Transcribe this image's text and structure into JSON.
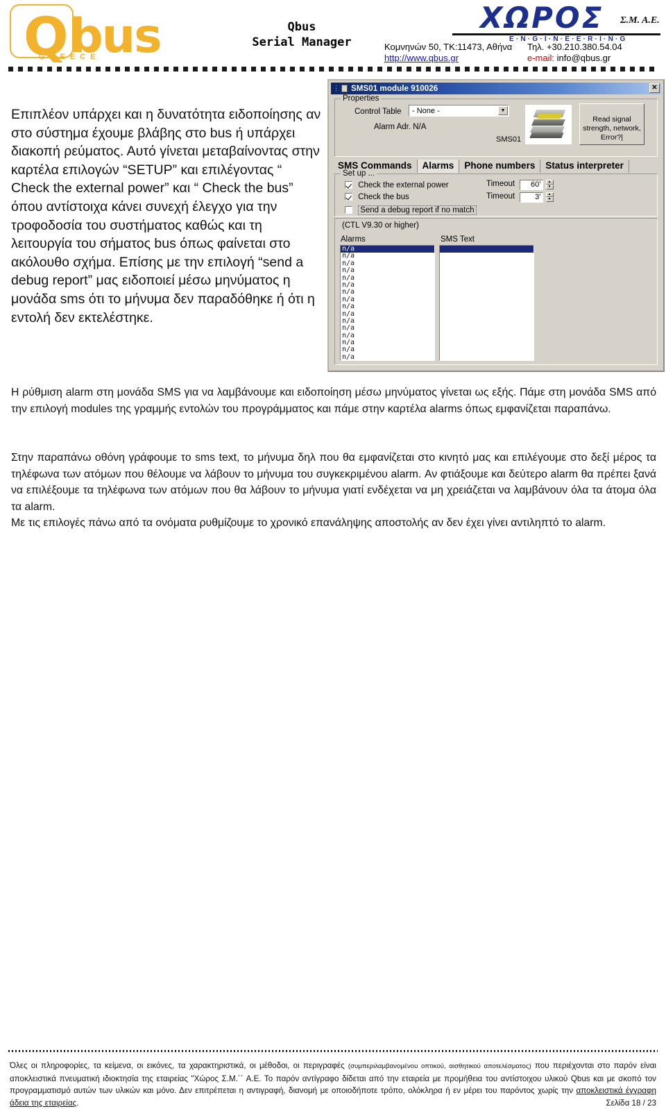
{
  "header": {
    "logo": {
      "q": "Q",
      "bus": "bus",
      "sub": "GREECE"
    },
    "app_title_line1": "Qbus",
    "app_title_line2": "Serial Manager",
    "company": {
      "name": "ΧΩΡΟΣ",
      "suffix": "Σ.Μ. Α.Ε.",
      "tagline": "E·N·G·I·N·E·E·R·I·N·G",
      "address": "Κομνηνών 50,  ΤΚ:11473, Αθήνα",
      "phone": "Τηλ. +30.210.380.54.04",
      "website": "http://www.qbus.gr",
      "email_label": "e-mail:",
      "email": "info@qbus.gr"
    },
    "accent_color": "#F2B22B",
    "company_color": "#1c2f8c",
    "email_color": "#cc0000",
    "link_color": "#1414cc"
  },
  "body": {
    "intro": "Επιπλέον υπάρχει και η δυνατότητα ειδοποίησης αν στο σύστημα έχουμε βλάβης στο bus ή υπάρχει διακοπή ρεύματος. Αυτό γίνεται μεταβαίνοντας στην καρτέλα επιλογών  “SETUP”  και επιλέγοντας “ Check the external power” και  “ Check the bus” όπου αντίστοιχα κάνει συνεχή έλεγχο για την τροφοδοσία του συστήματος καθώς και τη λειτουργία του σήματος bus όπως φαίνεται στο ακόλουθο σχήμα. Επίσης με την επιλογή “send a debug report” μας ειδοποιεί μέσω μηνύματος η μονάδα sms ότι το μήνυμα δεν παραδόθηκε ή ότι η εντολή δεν εκτελέστηκε.",
    "paragraph1": "Η ρύθμιση alarm στη μονάδα SMS για να λαμβάνουμε και ειδοποίηση μέσω μηνύματος γίνεται ως εξής. Πάμε στη μονάδα SMS από την επιλογή modules της γραμμής εντολών του προγράμματος και πάμε στην καρτέλα alarms όπως εμφανίζεται παραπάνω.",
    "paragraph2": "Στην παραπάνω οθόνη γράφουμε το sms text, το μήνυμα δηλ που θα εμφανίζεται στο κινητό μας και επιλέγουμε στο δεξί μέρος τα τηλέφωνα των ατόμων που θέλουμε να λάβουν το μήνυμα του συγκεκριμένου alarm. Αν φτιάξουμε και δεύτερο alarm θα πρέπει ξανά να επιλέξουμε τα τηλέφωνα των ατόμων που θα λάβουν το μήνυμα γιατί ενδέχεται να μη χρειάζεται να λαμβάνουν όλα τα άτομα όλα τα alarm.",
    "paragraph2b": "Με τις επιλογές πάνω από τα ονόματα ρυθμίζουμε το χρονικό επανάληψης αποστολής αν δεν έχει γίνει αντιληπτό το alarm."
  },
  "app_window": {
    "title": "SMS01 module 910026",
    "close_label": "✕",
    "properties": {
      "group_label": "Properties",
      "control_table_label": "Control Table",
      "control_table_value": "- None -",
      "alarm_adr_label": "Alarm Adr. N/A",
      "module_caption": "SMS01",
      "read_button": "Read signal strength, network, Error?|"
    },
    "tabs": [
      {
        "label": "SMS Commands",
        "active": false
      },
      {
        "label": "Alarms",
        "active": true
      },
      {
        "label": "Phone numbers",
        "active": false
      },
      {
        "label": "Status interpreter",
        "active": false
      }
    ],
    "setup": {
      "group_label": "Set up ...",
      "check_external_power": "Check the external power",
      "check_external_power_checked": true,
      "check_bus": "Check the bus",
      "check_bus_checked": true,
      "send_debug_report": "Send a debug report if no match",
      "send_debug_report_checked": false,
      "timeout_label_1": "Timeout",
      "timeout_value_1": "60'",
      "timeout_label_2": "Timeout",
      "timeout_value_2": "3'"
    },
    "alarms_panel": {
      "ctl_note": "(CTL V9.30 or higher)",
      "col_alarms": "Alarms",
      "col_sms_text": "SMS Text",
      "alarm_rows": [
        "n/a",
        "n/a",
        "n/a",
        "n/a",
        "n/a",
        "n/a",
        "n/a",
        "n/a",
        "n/a",
        "n/a",
        "n/a",
        "n/a",
        "n/a",
        "n/a",
        "n/a",
        "n/a"
      ],
      "selected_index": 0,
      "sms_text_rows": [
        "",
        "",
        "",
        "",
        "",
        "",
        "",
        "",
        "",
        "",
        "",
        "",
        "",
        "",
        "",
        ""
      ],
      "selection_color": "#1b2a78"
    }
  },
  "footer": {
    "line1a": "Όλες οι πληροφορίες, τα κείμενα, οι εικόνες, τα χαρακτηριστικά, οι μέθοδοι, οι περιγραφές ",
    "line1b": "(συμπεριλαμβανομένου οπτικού, αισθητικού αποτελέσματος)",
    "line2": "που περιέχονται στο παρόν είναι αποκλειστικά πνευματική ιδιοκτησία της εταιρείας \"Χώρος Σ.Μ.´´ Α.Ε.  Το παρόν αντίγραφο δίδεται από την",
    "line3": "εταιρεία με προμήθεια του αντίστοιχου υλικού Qbus και με σκοπό τον προγραμματισμό αυτών των υλικών και μόνο.  Δεν επιτρέπεται η αντιγραφή,",
    "line4a": "διανομή με οποιοδήποτε τρόπο, ολόκληρα ή εν μέρει του παρόντος χωρίς την ",
    "line4b": "αποκλειστικά έγγραφη άδεια της εταιρείας",
    "line4c": ".",
    "page_label": "Σελίδα 18 / 23"
  }
}
